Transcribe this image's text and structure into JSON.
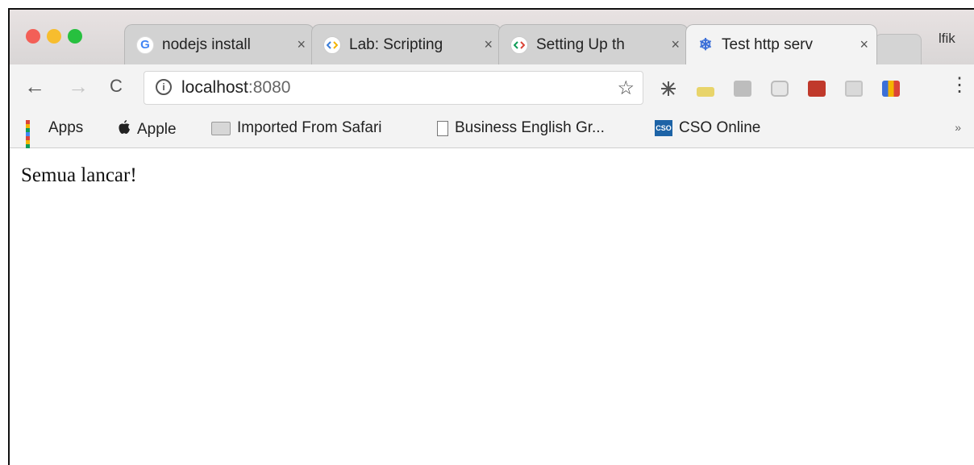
{
  "tabs": [
    {
      "title": "nodejs install",
      "close": "×",
      "icon": "google-g-icon"
    },
    {
      "title": "Lab: Scripting",
      "close": "×",
      "icon": "code-icon"
    },
    {
      "title": "Setting Up th",
      "close": "×",
      "icon": "code-icon"
    },
    {
      "title": "Test http serv",
      "close": "×",
      "icon": "snowflake-icon",
      "active": true
    }
  ],
  "profile": "lfik",
  "toolbar": {
    "back": "←",
    "forward": "→",
    "reload": "C",
    "url_host": "localhost",
    "url_port": ":8080",
    "star": "☆",
    "menu": "⋮"
  },
  "bookmarks": {
    "apps": "Apps",
    "apple": "Apple",
    "imported": "Imported From Safari",
    "business": "Business English Gr...",
    "cso": "CSO Online",
    "cso_icon_text": "CSO",
    "overflow": "»"
  },
  "content": {
    "text": "Semua lancar!"
  },
  "colors": {
    "close": "#f35f57",
    "minimize": "#f7bd2e",
    "maximize": "#27c03f"
  }
}
